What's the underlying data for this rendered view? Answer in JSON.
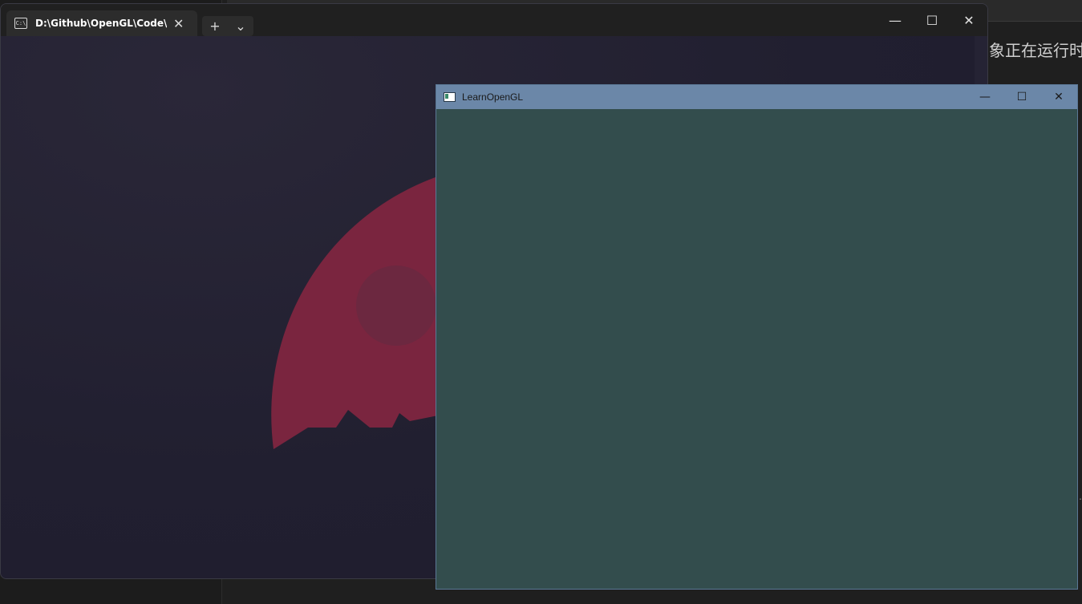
{
  "background_app": {
    "visible_text": "象正在运行时",
    "small_char": "…"
  },
  "terminal": {
    "tab_title": "D:\\Github\\OpenGL\\Code\\OpenGL",
    "tab_icon": "C:\\",
    "buttons": {
      "close_tab": "✕",
      "new_tab": "+",
      "dropdown": "⌄",
      "minimize": "—",
      "maximize": "☐",
      "close": "✕"
    },
    "colors": {
      "background": "#201e2f",
      "accent_shape": "#7a253f"
    }
  },
  "gl_window": {
    "title": "LearnOpenGL",
    "buttons": {
      "minimize": "—",
      "maximize": "☐",
      "close": "✕"
    },
    "clear_color": "#334d4d",
    "titlebar_color": "#6b87a8"
  }
}
